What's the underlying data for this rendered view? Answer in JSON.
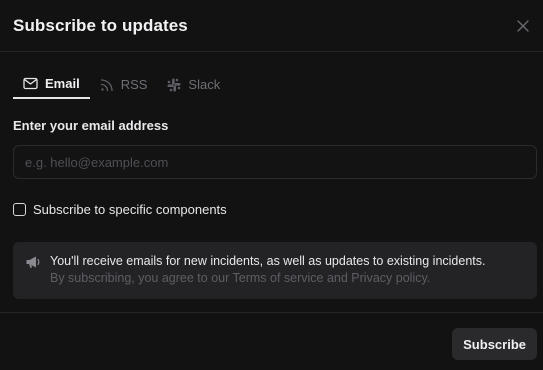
{
  "dialog": {
    "title": "Subscribe to updates"
  },
  "tabs": [
    {
      "label": "Email",
      "icon": "mail-icon",
      "active": true
    },
    {
      "label": "RSS",
      "icon": "rss-icon",
      "active": false
    },
    {
      "label": "Slack",
      "icon": "slack-icon",
      "active": false
    }
  ],
  "form": {
    "email_label": "Enter your email address",
    "email_placeholder": "e.g. hello@example.com",
    "email_value": "",
    "components_checkbox_label": "Subscribe to specific components",
    "components_checked": false
  },
  "notice": {
    "icon": "megaphone-icon",
    "primary": "You'll receive emails for new incidents, as well as updates to existing incidents.",
    "secondary": "By subscribing, you agree to our Terms of service and Privacy policy."
  },
  "footer": {
    "subscribe_label": "Subscribe"
  },
  "colors": {
    "background": "#121213",
    "notice_background": "#232326",
    "button_background": "#2a2a2d",
    "active_tab_text": "#f0f0f2",
    "inactive_tab_text": "#6e6e75"
  }
}
